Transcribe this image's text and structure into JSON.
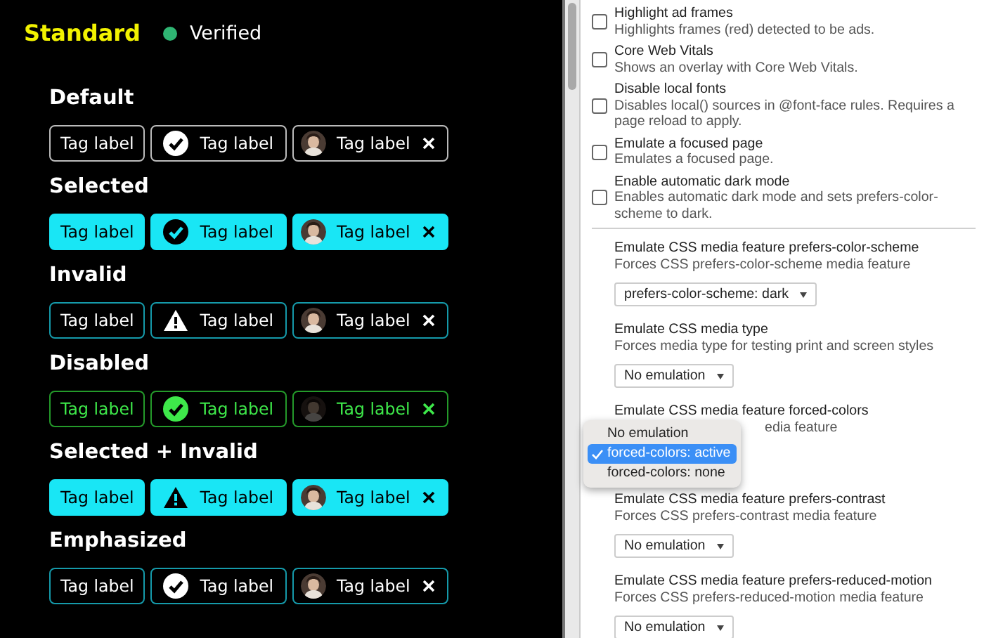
{
  "left": {
    "title": "Standard",
    "status": {
      "label": "Verified",
      "color": "#2fb573"
    },
    "sections": [
      {
        "heading": "Default",
        "selected": false,
        "invalid": false,
        "disabled": false,
        "emphasized": false,
        "tags": [
          {
            "kind": "plain",
            "label": "Tag label"
          },
          {
            "kind": "check",
            "label": "Tag label"
          },
          {
            "kind": "avatar",
            "label": "Tag label"
          }
        ]
      },
      {
        "heading": "Selected",
        "selected": true,
        "invalid": false,
        "disabled": false,
        "emphasized": false,
        "tags": [
          {
            "kind": "plain",
            "label": "Tag label"
          },
          {
            "kind": "check",
            "label": "Tag label"
          },
          {
            "kind": "avatar",
            "label": "Tag label"
          }
        ]
      },
      {
        "heading": "Invalid",
        "selected": false,
        "invalid": true,
        "disabled": false,
        "emphasized": false,
        "tags": [
          {
            "kind": "plain",
            "label": "Tag label"
          },
          {
            "kind": "alert",
            "label": "Tag label"
          },
          {
            "kind": "avatar",
            "label": "Tag label"
          }
        ]
      },
      {
        "heading": "Disabled",
        "selected": false,
        "invalid": false,
        "disabled": true,
        "emphasized": false,
        "tags": [
          {
            "kind": "plain",
            "label": "Tag label"
          },
          {
            "kind": "check",
            "label": "Tag label"
          },
          {
            "kind": "avatar",
            "label": "Tag label"
          }
        ]
      },
      {
        "heading": "Selected + Invalid",
        "selected": true,
        "invalid": true,
        "disabled": false,
        "emphasized": false,
        "tags": [
          {
            "kind": "plain",
            "label": "Tag label"
          },
          {
            "kind": "alert",
            "label": "Tag label"
          },
          {
            "kind": "avatar",
            "label": "Tag label"
          }
        ]
      },
      {
        "heading": "Emphasized",
        "selected": false,
        "invalid": false,
        "disabled": false,
        "emphasized": true,
        "tags": [
          {
            "kind": "plain",
            "label": "Tag label"
          },
          {
            "kind": "check",
            "label": "Tag label"
          },
          {
            "kind": "avatar",
            "label": "Tag label"
          }
        ]
      }
    ]
  },
  "settings": [
    {
      "kind": "checkbox",
      "title": "Highlight ad frames",
      "description": "Highlights frames (red) detected to be ads.",
      "checked": false
    },
    {
      "kind": "checkbox",
      "title": "Core Web Vitals",
      "description": "Shows an overlay with Core Web Vitals.",
      "checked": false
    },
    {
      "kind": "checkbox",
      "title": "Disable local fonts",
      "description": "Disables local() sources in @font-face rules. Requires a page reload to apply.",
      "checked": false
    },
    {
      "kind": "checkbox",
      "title": "Emulate a focused page",
      "description": "Emulates a focused page.",
      "checked": false
    },
    {
      "kind": "checkbox",
      "title": "Enable automatic dark mode",
      "description": "Enables automatic dark mode and sets prefers-color-scheme to dark.",
      "checked": false
    },
    {
      "kind": "divider"
    },
    {
      "kind": "select",
      "title": "Emulate CSS media feature prefers-color-scheme",
      "description": "Forces CSS prefers-color-scheme media feature",
      "value": "prefers-color-scheme: dark"
    },
    {
      "kind": "select",
      "title": "Emulate CSS media type",
      "description": "Forces media type for testing print and screen styles",
      "value": "No emulation"
    },
    {
      "kind": "open-select",
      "title": "Emulate CSS media feature forced-colors",
      "description": "edia feature",
      "options": [
        {
          "label": "No emulation",
          "selected": false
        },
        {
          "label": "forced-colors: active",
          "selected": true
        },
        {
          "label": "forced-colors: none",
          "selected": false
        }
      ]
    },
    {
      "kind": "select",
      "title": "Emulate CSS media feature prefers-contrast",
      "description": "Forces CSS prefers-contrast media feature",
      "value": "No emulation"
    },
    {
      "kind": "select",
      "title": "Emulate CSS media feature prefers-reduced-motion",
      "description": "Forces CSS prefers-reduced-motion media feature",
      "value": "No emulation"
    }
  ]
}
